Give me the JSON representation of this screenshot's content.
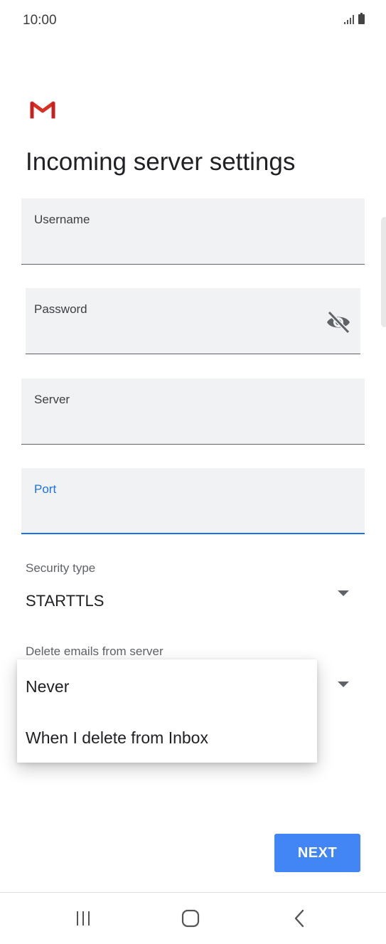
{
  "status_bar": {
    "time": "10:00"
  },
  "header": {
    "title": "Incoming server settings",
    "logo_icon": "gmail-m-logo"
  },
  "fields": {
    "username": {
      "label": "Username",
      "value": ""
    },
    "password": {
      "label": "Password",
      "value": "",
      "toggle_icon": "visibility-off-icon"
    },
    "server": {
      "label": "Server",
      "value": ""
    },
    "port": {
      "label": "Port",
      "value": "",
      "focused": true
    }
  },
  "security": {
    "label": "Security type",
    "value": "STARTTLS"
  },
  "delete_emails": {
    "label": "Delete emails from server",
    "options": [
      "Never",
      "When I delete from Inbox"
    ]
  },
  "next_button": {
    "label": "NEXT"
  },
  "nav": {
    "recents_icon": "recents-icon",
    "home_icon": "home-icon",
    "back_icon": "back-icon"
  },
  "colors": {
    "accent": "#1a73e8",
    "button": "#4285f4",
    "field_bg": "#f1f2f4"
  }
}
